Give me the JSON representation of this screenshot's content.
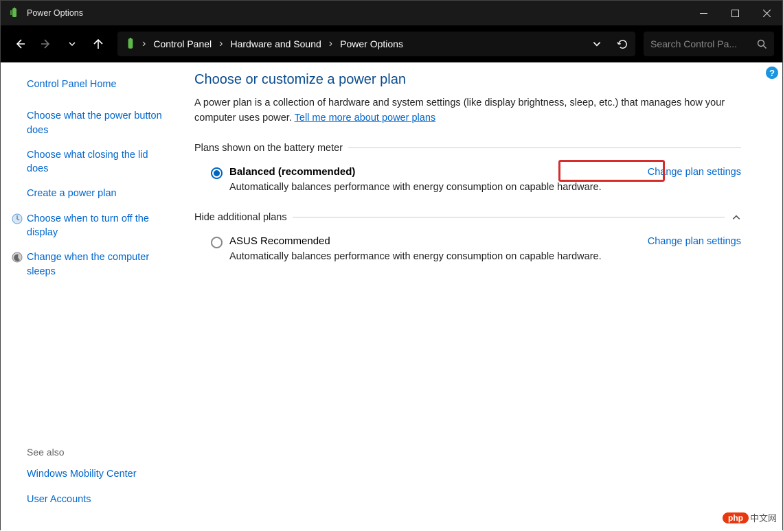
{
  "window": {
    "title": "Power Options"
  },
  "breadcrumb": {
    "items": [
      "Control Panel",
      "Hardware and Sound",
      "Power Options"
    ]
  },
  "search": {
    "placeholder": "Search Control Pa..."
  },
  "sidebar": {
    "home": "Control Panel Home",
    "links": [
      "Choose what the power button does",
      "Choose what closing the lid does",
      "Create a power plan",
      "Choose when to turn off the display",
      "Change when the computer sleeps"
    ],
    "see_also_label": "See also",
    "see_also": [
      "Windows Mobility Center",
      "User Accounts"
    ]
  },
  "main": {
    "heading": "Choose or customize a power plan",
    "desc_before": "A power plan is a collection of hardware and system settings (like display brightness, sleep, etc.) that manages how your computer uses power. ",
    "desc_link": "Tell me more about power plans",
    "section1": "Plans shown on the battery meter",
    "section2": "Hide additional plans",
    "plan1": {
      "title": "Balanced (recommended)",
      "desc": "Automatically balances performance with energy consumption on capable hardware.",
      "link": "Change plan settings"
    },
    "plan2": {
      "title": "ASUS Recommended",
      "desc": "Automatically balances performance with energy consumption on capable hardware.",
      "link": "Change plan settings"
    }
  },
  "watermark": {
    "pill": "php",
    "text": "中文网"
  }
}
